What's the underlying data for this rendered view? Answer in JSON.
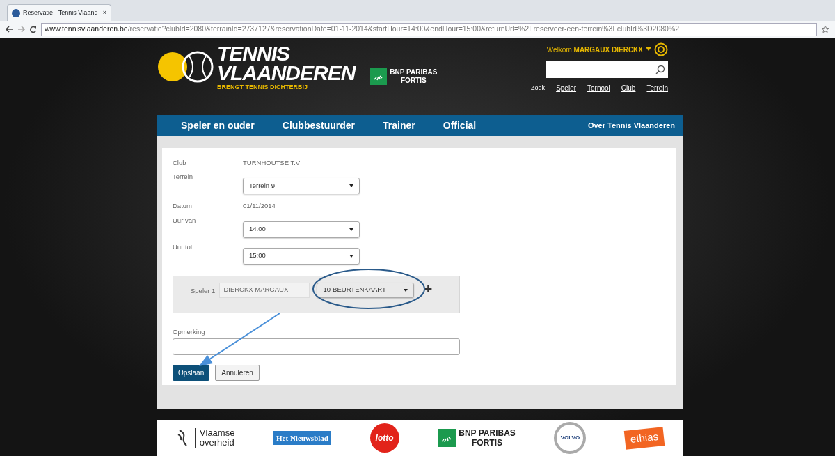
{
  "browser": {
    "tab_title": "Reservatie - Tennis Vlaand",
    "tab_close": "×",
    "url_domain": "www.tennisvlaanderen.be",
    "url_path": "/reservatie?clubId=2080&terrainId=2737127&reservationDate=01-11-2014&startHour=14:00&endHour=15:00&returnUrl=%2Freserveer-een-terrein%3FclubId%3D2080%2"
  },
  "header": {
    "logo_lines": [
      "TENNIS",
      "VLAANDEREN"
    ],
    "tagline": "BRENGT TENNIS DICHTERBIJ",
    "sponsor_lines": [
      "BNP PARIBAS",
      "FORTIS"
    ],
    "welcome": "Welkom",
    "user": "MARGAUX DIERCKX",
    "search_label": "Zoek",
    "search_links": [
      "Speler",
      "Tornooi",
      "Club",
      "Terrein"
    ]
  },
  "nav": {
    "items": [
      "Speler en ouder",
      "Clubbestuurder",
      "Trainer",
      "Official"
    ],
    "right_link": "Over Tennis Vlaanderen"
  },
  "form": {
    "fields": [
      {
        "label": "Club",
        "kind": "text",
        "value": "TURNHOUTSE T.V"
      },
      {
        "label": "Terrein",
        "kind": "select",
        "value": "Terrein 9"
      },
      {
        "label": "Datum",
        "kind": "text",
        "value": "01/11/2014"
      },
      {
        "label": "Uur van",
        "kind": "select",
        "value": "14:00"
      },
      {
        "label": "Uur tot",
        "kind": "select",
        "value": "15:00"
      }
    ],
    "player": {
      "label": "Speler 1",
      "name": "DIERCKX MARGAUX",
      "ticket": "10-BEURTENKAART",
      "add": "+"
    },
    "remark_label": "Opmerking",
    "buttons": [
      {
        "label": "Opslaan",
        "kind": "primary"
      },
      {
        "label": "Annuleren",
        "kind": "secondary"
      }
    ]
  },
  "footer": {
    "logos": [
      {
        "kind": "vlaanderen",
        "lines": [
          "Vlaamse",
          "overheid"
        ]
      },
      {
        "kind": "nieuwsblad",
        "lines": [
          "Het Nieuwsblad"
        ]
      },
      {
        "kind": "lotto",
        "lines": [
          "lotto"
        ]
      },
      {
        "kind": "bnp",
        "lines": [
          "BNP PARIBAS",
          "FORTIS"
        ]
      },
      {
        "kind": "volvo",
        "lines": [
          "VOLVO"
        ]
      },
      {
        "kind": "ethias",
        "lines": [
          "ethias"
        ]
      }
    ]
  }
}
